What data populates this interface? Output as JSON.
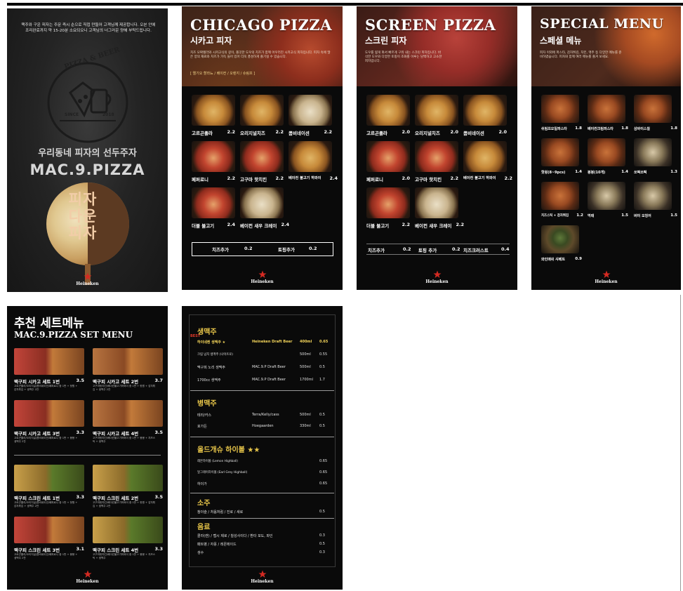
{
  "colors": {
    "panel_bg": "#0a0a0a",
    "accent_gold": "#e8c64a",
    "accent_red": "#e13a2a",
    "heineken_red": "#d42a22"
  },
  "brand_logo": "Heineken",
  "cover": {
    "intro": "맥주와 구운 피자는 주문 즉시 순으로 직접 만들어 고객님께 제공합니다. 오븐 안에 조리완료까지 약 15-20분 소요되오니 고객님의 너그러운 양해 부탁드립니다.",
    "emblem_top": "PIZZA & BEER",
    "emblem_since": "SINCE",
    "emblem_year": "2018",
    "slogan": "우리동네 피자의 선두주자",
    "brand": "MAC.9.PIZZA",
    "vertical_text": "피자 다운 피자"
  },
  "chicago": {
    "title": "CHICAGO PIZZA",
    "subtitle": "시카고 피자",
    "desc": "치즈 모짜렐라와 시카고식의 깊이, 쫄깃한 도우의 치즈가 함께 어우러진 시카고식 피자입니다. 피자 속에 많은 양의 재료와 치즈가 가득 들어 있어 더욱 풍성하게 즐기실 수 있습니다.",
    "options": "[ 엘기오 할라뇨 / 베이컨 / 오렌지 / 슈림프 ]",
    "items": [
      {
        "name": "고르곤졸라",
        "price": "2.2"
      },
      {
        "name": "오리지널치즈",
        "price": "2.2"
      },
      {
        "name": "콤비네이션",
        "price": "2.2"
      },
      {
        "name": "페퍼로니",
        "price": "2.2"
      },
      {
        "name": "고구마 핫치킨",
        "price": "2.2"
      },
      {
        "name": "베이컨 불고기 하와이",
        "price": "2.4"
      },
      {
        "name": "더블 불고기",
        "price": "2.4"
      },
      {
        "name": "베이컨 새우 크레이",
        "price": "2.4"
      }
    ],
    "addons": [
      {
        "name": "치즈추가",
        "price": "0.2"
      },
      {
        "name": "토핑추가",
        "price": "0.2"
      }
    ]
  },
  "screen": {
    "title": "SCREEN PIZZA",
    "subtitle": "스크린 피자",
    "desc": "도우를 얇게 펴서 빠르게 구워 내는 스크린 피자입니다. 바삭한 도우와 다양한 토핑이 조화를 이루는 담백하고 고소한 피자입니다.",
    "items": [
      {
        "name": "고르곤졸라",
        "price": "2.0"
      },
      {
        "name": "오리지널치즈",
        "price": "2.0"
      },
      {
        "name": "콤비네이션",
        "price": "2.0"
      },
      {
        "name": "페퍼로니",
        "price": "2.0"
      },
      {
        "name": "고구마 핫치킨",
        "price": "2.2"
      },
      {
        "name": "베이컨 불고기 하와이",
        "price": "2.2"
      },
      {
        "name": "더블 불고기",
        "price": "2.2"
      },
      {
        "name": "베이컨 새우 크레이",
        "price": "2.2"
      }
    ],
    "addons": [
      {
        "name": "치즈추가",
        "price": "0.2"
      },
      {
        "name": "토핑 추가",
        "price": "0.2"
      },
      {
        "name": "치즈크러스트",
        "price": "0.4"
      }
    ]
  },
  "special": {
    "title": "SPECIAL MENU",
    "subtitle": "스페셜 메뉴",
    "desc": "피자 이외에 파스타, 감자튀김, 치킨, 맥주 등 다양한 메뉴를 준비하였습니다. 피자와 함께 여러 메뉴를 즐겨 보세요.",
    "items": [
      {
        "name": "쉬림프오일파스타",
        "price": "1.8"
      },
      {
        "name": "베이컨크림파스타",
        "price": "1.8"
      },
      {
        "name": "삼바이스칠",
        "price": "1.8"
      },
      {
        "name": "핫윙(8~9pcs)",
        "price": "1.4"
      },
      {
        "name": "봉봉(10개)",
        "price": "1.4"
      },
      {
        "name": "쏘떡쏘떡",
        "price": "1.3"
      },
      {
        "name": "치즈스틱 + 감자튀김",
        "price": "1.2"
      },
      {
        "name": "먹태",
        "price": "1.5"
      },
      {
        "name": "버터 오징어",
        "price": "1.5"
      },
      {
        "name": "와인매쉬 샤베트",
        "price": "0.9"
      }
    ]
  },
  "setmenu": {
    "title": "추천 세트메뉴",
    "subtitle": "MAC.9.PIZZA SET MENU",
    "items": [
      {
        "name": "맥구피 시카고 세트 1번",
        "price": "3.5",
        "desc": "고르곤졸라/오리지널/콤비네이션/페퍼로니 중 1판 + 핫윙 + 감자튀김 + 생맥주 2잔"
      },
      {
        "name": "맥구피 시카고 세트 2번",
        "price": "3.7",
        "desc": "고구마핫치킨/베이컨불고기하와이 중 1판 + 핫윙 + 감자튀김 + 생맥주 2잔"
      },
      {
        "name": "맥구피 시카고 세트 3번",
        "price": "3.3",
        "desc": "고르곤졸라/오리지널/콤비네이션/페퍼로니 중 1판 + 봉봉 + 생맥주 2잔"
      },
      {
        "name": "맥구피 시카고 세트 4번",
        "price": "3.5",
        "desc": "고구마핫치킨/베이컨불고기하와이 중 1판 + 봉봉 + 치즈스틱 + 생맥주"
      },
      {
        "name": "맥구피 스크린 세트 1번",
        "price": "3.3",
        "desc": "고르곤졸라/오리지널/콤비네이션/페퍼로니 중 1판 + 핫윙 + 감자튀김 + 생맥주 2잔"
      },
      {
        "name": "맥구피 스크린 세트 2번",
        "price": "3.5",
        "desc": "고구마핫치킨/베이컨불고기하와이 중 1판 + 핫윙 + 감자튀김 + 생맥주 2잔"
      },
      {
        "name": "맥구피 스크린 세트 3번",
        "price": "3.1",
        "desc": "고르곤졸라/오리지널/콤비네이션/페퍼로니 중 1판 + 봉봉 + 생맥주 2잔"
      },
      {
        "name": "맥구피 스크린 세트 4번",
        "price": "3.3",
        "desc": "고구마핫치킨/베이컨불고기하와이 중 1판 + 봉봉 + 치즈스틱 + 생맥주"
      }
    ]
  },
  "drinks": {
    "best_label": "BEST",
    "sections": [
      {
        "title": "생맥주",
        "rows": [
          {
            "name": "하이네켄 생맥주 ★",
            "type": "Heineken Draft Beer",
            "vol": "400ml",
            "price": "0.65",
            "highlight": true
          },
          {
            "name": "크림 넘치 생맥주 (나이트로)",
            "type": "",
            "vol": "500ml",
            "price": "0.55",
            "highlight": false
          },
          {
            "name": "맥구피 노리 생맥주",
            "type": "MAC.9.P Draft Beer",
            "vol": "500ml",
            "price": "0.5",
            "highlight": false
          },
          {
            "name": "1700cc 생맥주",
            "type": "MAC.9.P Draft Beer",
            "vol": "1700ml",
            "price": "1.7",
            "highlight": false
          }
        ]
      },
      {
        "title": "병맥주",
        "rows": [
          {
            "name": "테라/카스",
            "type": "Terra/Kelly/cass",
            "vol": "500ml",
            "price": "0.5",
            "highlight": false
          },
          {
            "name": "호가든",
            "type": "Hoegaarden",
            "vol": "330ml",
            "price": "0.5",
            "highlight": false
          }
        ]
      },
      {
        "title": "올드개슈 하이볼 ★★",
        "rows": [
          {
            "name": "레몬하이볼 (Lemon Highball)",
            "type": "",
            "vol": "",
            "price": "0.65",
            "highlight": false
          },
          {
            "name": "얼그레이하이볼 (Earl Grey Highball)",
            "type": "",
            "vol": "",
            "price": "0.65",
            "highlight": false
          },
          {
            "name": "하이가",
            "type": "",
            "vol": "",
            "price": "0.65",
            "highlight": false
          }
        ]
      },
      {
        "title": "소주",
        "rows": [
          {
            "name": "참이슬 / 처음처럼 / 진로 / 새로",
            "type": "",
            "vol": "",
            "price": "0.5",
            "highlight": false
          }
        ]
      },
      {
        "title": "음료",
        "rows": [
          {
            "name": "콜라(캔) / 펩시 제로 / 칠성사이다 / 환타 포도, 파인",
            "type": "",
            "vol": "",
            "price": "0.3",
            "highlight": false
          },
          {
            "name": "패트병 / 자몽 / 레몬에이드",
            "type": "",
            "vol": "",
            "price": "0.5",
            "highlight": false
          },
          {
            "name": "생수",
            "type": "",
            "vol": "",
            "price": "0.3",
            "highlight": false
          }
        ]
      }
    ]
  }
}
